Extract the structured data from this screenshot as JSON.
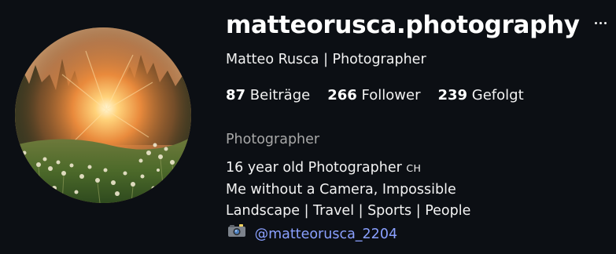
{
  "profile": {
    "username": "matteorusca.photography",
    "display_name": "Matteo Rusca | Photographer",
    "category": "Photographer"
  },
  "stats": [
    {
      "value": "87",
      "label": "Beiträge"
    },
    {
      "value": "266",
      "label": "Follower"
    },
    {
      "value": "239",
      "label": "Gefolgt"
    }
  ],
  "bio": {
    "line1_text": "16 year old Photographer ",
    "line1_suffix": "CH",
    "line2": "Me without a Camera, Impossible",
    "line3": "Landscape | Travel | Sports | People",
    "mention": "@matteorusca_2204"
  },
  "icons": {
    "more": "more-horizontal-icon",
    "camera": "camera-with-flash-icon"
  },
  "colors": {
    "background": "#0c0f14",
    "mention": "#8aa0ff",
    "muted": "#a8a8a8"
  }
}
